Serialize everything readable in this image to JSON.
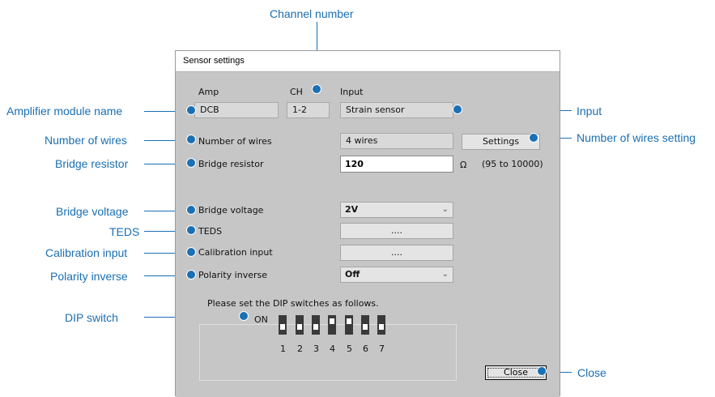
{
  "callouts": {
    "channel_number": "Channel number",
    "amplifier_module_name": "Amplifier module name",
    "input": "Input",
    "number_of_wires": "Number of wires",
    "number_of_wires_setting": "Number of wires setting",
    "bridge_resistor": "Bridge resistor",
    "bridge_voltage": "Bridge voltage",
    "teds": "TEDS",
    "calibration_input": "Calibration input",
    "polarity_inverse": "Polarity inverse",
    "dip_switch": "DIP switch",
    "close": "Close"
  },
  "dialog": {
    "title": "Sensor settings",
    "headers": {
      "amp": "Amp",
      "ch": "CH",
      "input": "Input"
    },
    "amp_value": "DCB",
    "ch_value": "1-2",
    "input_value": "Strain sensor",
    "number_of_wires": {
      "label": "Number of wires",
      "value": "4 wires",
      "button": "Settings"
    },
    "bridge_resistor": {
      "label": "Bridge resistor",
      "value": "120",
      "unit": "Ω",
      "range": "(95 to 10000)"
    },
    "bridge_voltage": {
      "label": "Bridge voltage",
      "value": "2V"
    },
    "teds": {
      "label": "TEDS",
      "button": "...."
    },
    "calibration_input": {
      "label": "Calibration input",
      "button": "...."
    },
    "polarity_inverse": {
      "label": "Polarity inverse",
      "value": "Off"
    },
    "dip": {
      "legend": "Please set the DIP switches as follows.",
      "on_label": "ON",
      "switches": [
        "1",
        "2",
        "3",
        "4",
        "5",
        "6",
        "7"
      ]
    },
    "close_button": "Close"
  },
  "colors": {
    "accent": "#1b6fb3",
    "dialog_bg": "#c6c6c6"
  },
  "icons": {
    "dropdown": "chevron-down-icon"
  }
}
